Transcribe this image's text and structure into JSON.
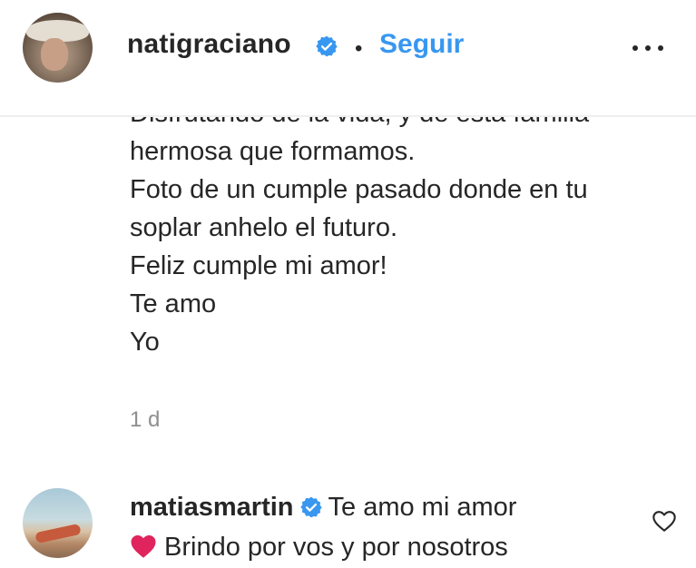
{
  "header": {
    "username": "natigraciano",
    "separator": "•",
    "follow_label": "Seguir",
    "icons": {
      "verified": "verified-badge-icon",
      "more": "more-options-icon"
    }
  },
  "post": {
    "caption_lines": [
      "Disfrutando de la vida, y de esta familia",
      "hermosa que formamos.",
      "Foto de un cumple pasado donde en tu",
      "soplar anhelo el futuro.",
      "Feliz cumple mi amor!",
      "Te amo",
      "Yo"
    ],
    "timestamp": "1 d"
  },
  "comment": {
    "username": "matiasmartin",
    "text_line1": "Te amo mi amor",
    "text_line2": "Brindo por vos y por nosotros",
    "icons": {
      "verified": "verified-badge-icon",
      "emoji": "red-heart-emoji",
      "like": "heart-outline-icon"
    }
  },
  "colors": {
    "text": "#262626",
    "link_blue": "#3897f0",
    "verified_blue": "#3897f0",
    "muted": "#8e8e8e",
    "divider": "#efefef",
    "heart_red": "#e0245e"
  }
}
